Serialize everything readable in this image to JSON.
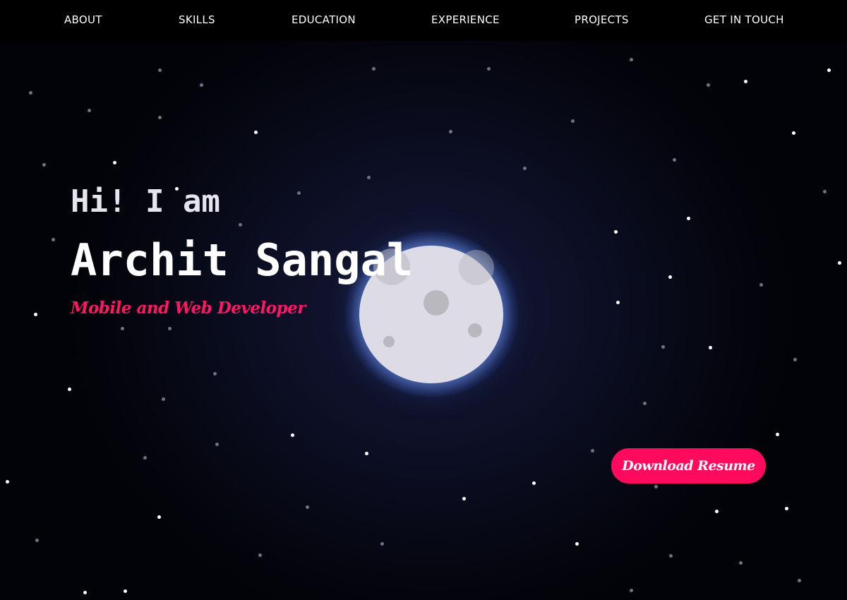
{
  "nav": {
    "items": [
      {
        "label": "ABOUT"
      },
      {
        "label": "SKILLS"
      },
      {
        "label": "EDUCATION"
      },
      {
        "label": "EXPERIENCE"
      },
      {
        "label": "PROJECTS"
      },
      {
        "label": "GET IN TOUCH"
      }
    ]
  },
  "hero": {
    "greeting": "Hi! I am",
    "name": "Archit Sangal",
    "role": "Mobile and Web Developer",
    "resume_button": "Download Resume"
  },
  "colors": {
    "accent": "#ff0a5c",
    "role_text": "#ff1766",
    "nav_background": "#000000",
    "moon": "#dcdbe6",
    "background": "#0c0f24"
  }
}
